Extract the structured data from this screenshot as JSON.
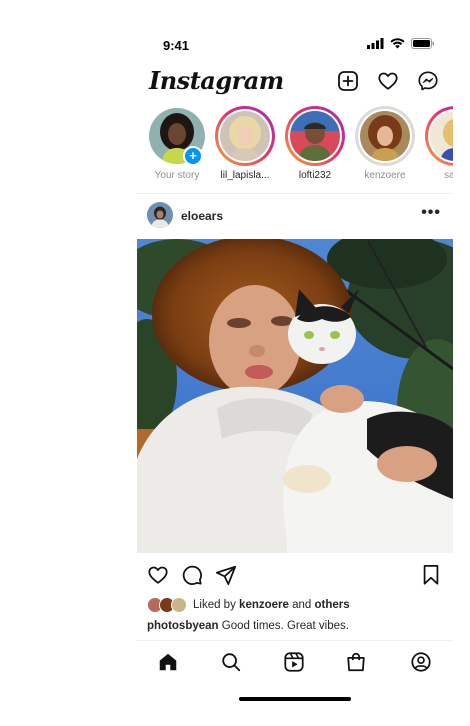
{
  "status": {
    "time": "9:41"
  },
  "header": {
    "logo": "Instagram"
  },
  "stories": [
    {
      "label": "Your story",
      "own": true
    },
    {
      "label": "lil_lapisla..."
    },
    {
      "label": "lofti232"
    },
    {
      "label": "kenzoere"
    },
    {
      "label": "sapp"
    }
  ],
  "post": {
    "username": "eloears",
    "more": "•••",
    "likes": {
      "prefix": "Liked by",
      "user": "kenzoere",
      "middle": "and",
      "others": "others"
    },
    "caption": {
      "user": "photosbyean",
      "text": "Good times. Great vibes."
    }
  },
  "colors": {
    "accent": "#0095f6",
    "ring_start": "#f9a23a",
    "ring_mid": "#e1306c",
    "ring_end": "#a22bc0"
  }
}
